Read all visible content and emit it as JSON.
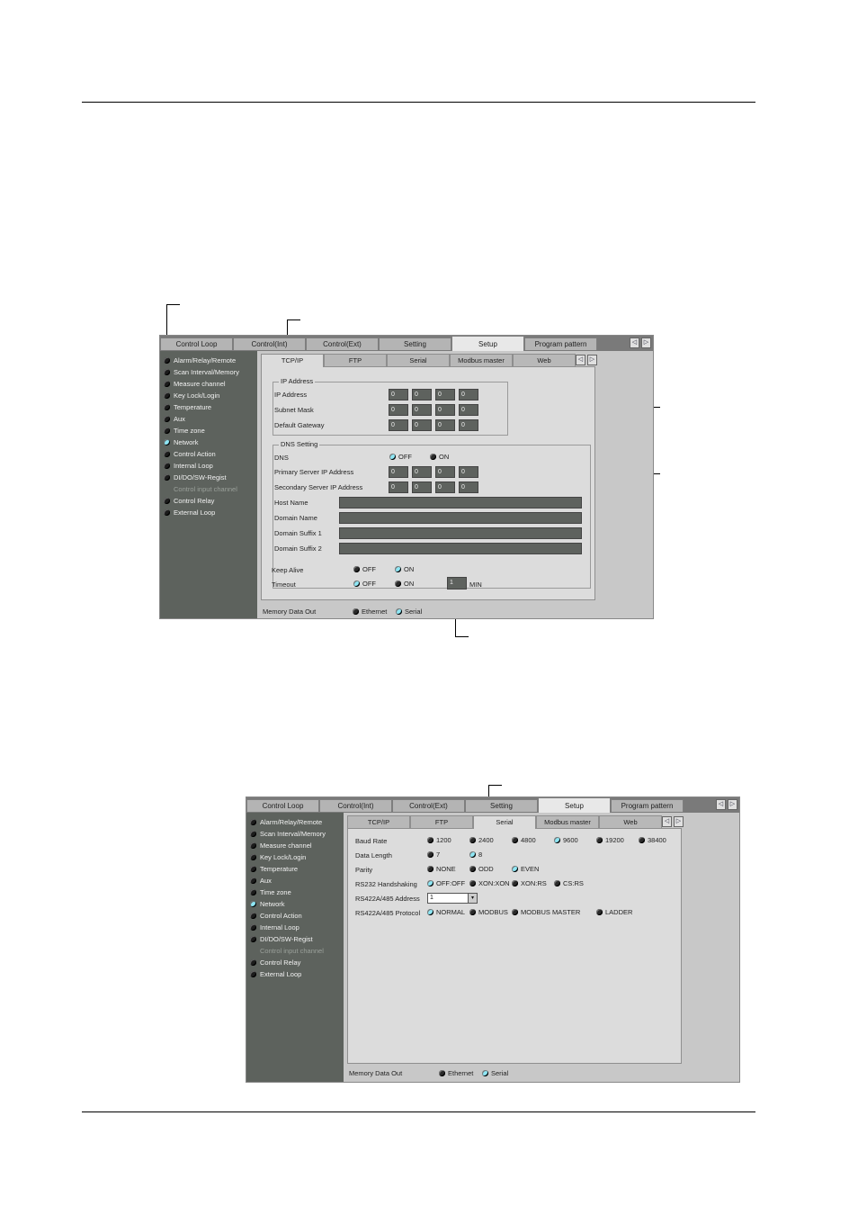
{
  "sidebar_items": [
    {
      "label": "Alarm/Relay/Remote",
      "on": false
    },
    {
      "label": "Scan Interval/Memory",
      "on": false
    },
    {
      "label": "Measure channel",
      "on": false
    },
    {
      "label": "Key Lock/Login",
      "on": false
    },
    {
      "label": "Temperature",
      "on": false
    },
    {
      "label": "Aux",
      "on": false
    },
    {
      "label": "Time zone",
      "on": false
    },
    {
      "label": "Network",
      "on": true
    },
    {
      "label": "Control Action",
      "on": false
    },
    {
      "label": "Internal Loop",
      "on": false
    },
    {
      "label": "DI/DO/SW-Regist",
      "on": false
    },
    {
      "label": "Control input channel",
      "dim": true
    },
    {
      "label": "Control Relay",
      "on": false
    },
    {
      "label": "External Loop",
      "on": false
    }
  ],
  "main_tabs": [
    "Control Loop",
    "Control(Int)",
    "Control(Ext)",
    "Setting",
    "Setup",
    "Program pattern"
  ],
  "main_active": "Setup",
  "sub_tabs": [
    "TCP/IP",
    "FTP",
    "Serial",
    "Modbus master",
    "Web"
  ],
  "arrow_left": "◁",
  "arrow_right": "▷",
  "screen1": {
    "active_sub": "TCP/IP",
    "ip_group_title": "IP Address",
    "ip_rows": [
      {
        "label": "IP Address",
        "octets": [
          "0",
          "0",
          "0",
          "0"
        ]
      },
      {
        "label": "Subnet Mask",
        "octets": [
          "0",
          "0",
          "0",
          "0"
        ]
      },
      {
        "label": "Default Gateway",
        "octets": [
          "0",
          "0",
          "0",
          "0"
        ]
      }
    ],
    "dns_group_title": "DNS Setting",
    "dns_label": "DNS",
    "dns_off": "OFF",
    "dns_on": "ON",
    "dns_rows": [
      {
        "label": "Primary Server IP Address",
        "octets": [
          "0",
          "0",
          "0",
          "0"
        ]
      },
      {
        "label": "Secondary Server IP Address",
        "octets": [
          "0",
          "0",
          "0",
          "0"
        ]
      }
    ],
    "text_rows": [
      "Host Name",
      "Domain Name",
      "Domain Suffix 1",
      "Domain Suffix 2"
    ],
    "keep_alive_label": "Keep Alive",
    "keep_alive_off": "OFF",
    "keep_alive_on": "ON",
    "timeout_label": "Timeout",
    "timeout_off": "OFF",
    "timeout_on": "ON",
    "timeout_value": "1",
    "timeout_unit": "MIN"
  },
  "memory_out_label": "Memory Data Out",
  "memory_ethernet": "Ethernet",
  "memory_serial": "Serial",
  "screen2": {
    "active_sub": "Serial",
    "baud_label": "Baud Rate",
    "baud_options": [
      "1200",
      "2400",
      "4800",
      "9600",
      "19200",
      "38400"
    ],
    "baud_selected": "9600",
    "data_length_label": "Data Length",
    "data_length_options": [
      "7",
      "8"
    ],
    "data_length_selected": "8",
    "parity_label": "Parity",
    "parity_options": [
      "NONE",
      "ODD",
      "EVEN"
    ],
    "parity_selected": "EVEN",
    "handshake_label": "RS232 Handshaking",
    "handshake_options": [
      "OFF:OFF",
      "XON:XON",
      "XON:RS",
      "CS:RS"
    ],
    "handshake_selected": "OFF:OFF",
    "address_label": "RS422A/485 Address",
    "address_value": "1",
    "protocol_label": "RS422A/485 Protocol",
    "protocol_options": [
      "NORMAL",
      "MODBUS",
      "MODBUS MASTER",
      "LADDER"
    ],
    "protocol_selected": "NORMAL"
  }
}
